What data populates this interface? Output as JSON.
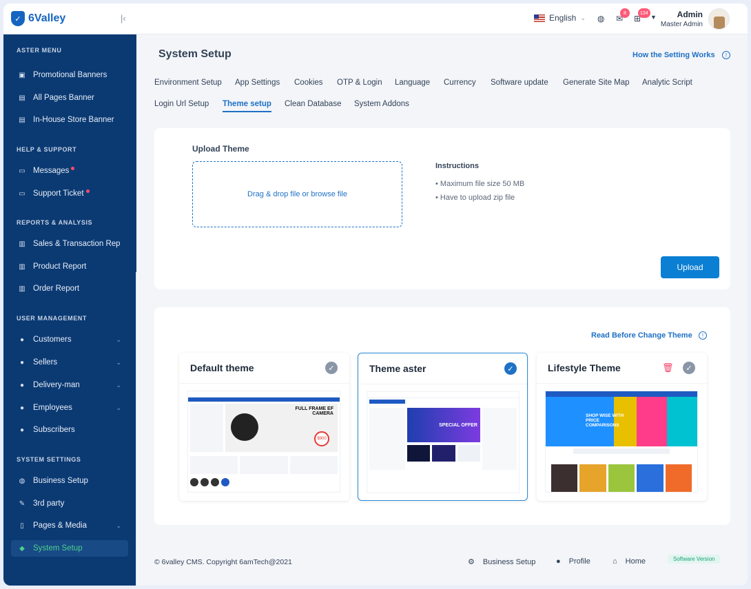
{
  "brand": {
    "name": "6Valley"
  },
  "sidebar": {
    "sections": [
      {
        "title": "ASTER MENU",
        "items": [
          {
            "label": "Promotional Banners",
            "icon": "image-icon"
          },
          {
            "label": "All Pages Banner",
            "icon": "store-icon"
          },
          {
            "label": "In-House Store Banner",
            "icon": "store-icon"
          }
        ]
      },
      {
        "title": "HELP & SUPPORT",
        "items": [
          {
            "label": "Messages",
            "icon": "chat-icon"
          },
          {
            "label": "Support Ticket",
            "icon": "ticket-icon"
          }
        ]
      },
      {
        "title": "REPORTS & ANALYSIS",
        "items": [
          {
            "label": "Sales & Transaction Rep",
            "icon": "chart-icon"
          },
          {
            "label": "Product Report",
            "icon": "chart-icon"
          },
          {
            "label": "Order Report",
            "icon": "chart-icon"
          }
        ]
      },
      {
        "title": "USER MANAGEMENT",
        "items": [
          {
            "label": "Customers",
            "icon": "user-icon"
          },
          {
            "label": "Sellers",
            "icon": "user-icon"
          },
          {
            "label": "Delivery-man",
            "icon": "user-icon"
          },
          {
            "label": "Employees",
            "icon": "user-icon"
          },
          {
            "label": "Subscribers",
            "icon": "user-icon"
          }
        ]
      },
      {
        "title": "SYSTEM SETTINGS",
        "items": [
          {
            "label": "Business Setup",
            "icon": "globe-icon"
          },
          {
            "label": "3rd party",
            "icon": "wrench-icon"
          },
          {
            "label": "Pages & Media",
            "icon": "pages-icon"
          },
          {
            "label": "System Setup",
            "icon": "shield-icon"
          }
        ]
      }
    ]
  },
  "topbar": {
    "language": "English",
    "messages_count": "8",
    "cart_count": "134",
    "user_name": "Admin",
    "user_role": "Master Admin"
  },
  "page": {
    "title": "System Setup",
    "how_link": "How the Setting Works",
    "tabs": [
      "Environment Setup",
      "App Settings",
      "Cookies",
      "OTP & Login",
      "Language",
      "Currency",
      "Software update",
      "Generate Site Map",
      "Analytic Script",
      "Login Url Setup",
      "Theme setup",
      "Clean Database",
      "System Addons"
    ]
  },
  "upload": {
    "title": "Upload Theme",
    "dropzone": "Drag & drop file or browse file",
    "instructions_title": "Instructions",
    "instructions": [
      "Maximum file size 50 MB",
      "Have to upload zip file"
    ],
    "button": "Upload"
  },
  "themes": {
    "read_before": "Read Before Change Theme",
    "items": [
      {
        "name": "Default theme",
        "selected": false,
        "preview_banner": "FULL FRAME EF CAMERA",
        "price": "$900"
      },
      {
        "name": "Theme aster",
        "selected": true,
        "preview_banner": "SPECIAL OFFER"
      },
      {
        "name": "Lifestyle Theme",
        "selected": false,
        "preview_banner": "SHOP WISE WITH PRICE COMPARISONS"
      }
    ]
  },
  "footer": {
    "copyright": "© 6valley CMS. Copyright 6amTech@2021",
    "links": [
      "Business Setup",
      "Profile",
      "Home"
    ],
    "version": "Software Version"
  },
  "colors": {
    "sidebar": "#0b3a73",
    "accent": "#1e71c5",
    "active_text": "#4dd08a",
    "badge": "#ff5b79"
  }
}
